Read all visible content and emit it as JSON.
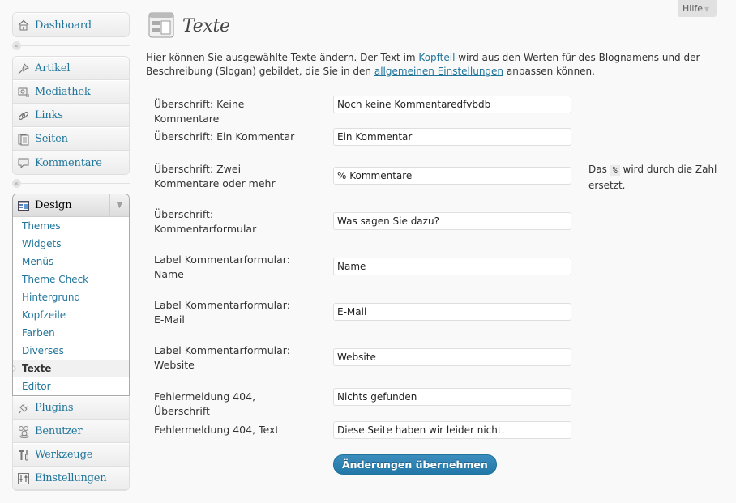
{
  "help": {
    "label": "Hilfe"
  },
  "sidebar": {
    "top": [
      {
        "label": "Dashboard",
        "icon": "dashboard-icon"
      }
    ],
    "content": [
      {
        "label": "Artikel",
        "icon": "pushpin-icon"
      },
      {
        "label": "Mediathek",
        "icon": "media-icon"
      },
      {
        "label": "Links",
        "icon": "link-icon"
      },
      {
        "label": "Seiten",
        "icon": "pages-icon"
      },
      {
        "label": "Kommentare",
        "icon": "comment-icon"
      }
    ],
    "design": {
      "label": "Design",
      "icon": "appearance-icon",
      "submenu": [
        {
          "label": "Themes"
        },
        {
          "label": "Widgets"
        },
        {
          "label": "Menüs"
        },
        {
          "label": "Theme Check"
        },
        {
          "label": "Hintergrund"
        },
        {
          "label": "Kopfzeile"
        },
        {
          "label": "Farben"
        },
        {
          "label": "Diverses"
        },
        {
          "label": "Texte",
          "current": true
        },
        {
          "label": "Editor"
        }
      ]
    },
    "bottom": [
      {
        "label": "Plugins",
        "icon": "plugin-icon"
      },
      {
        "label": "Benutzer",
        "icon": "users-icon"
      },
      {
        "label": "Werkzeuge",
        "icon": "tools-icon"
      },
      {
        "label": "Einstellungen",
        "icon": "settings-icon"
      }
    ]
  },
  "page": {
    "title": "Texte",
    "intro": {
      "part1": "Hier können Sie ausgewählte Texte ändern. Der Text im ",
      "link1": "Kopfteil",
      "part2": " wird aus den Werten für des Blognamens und der Beschreibung (Slogan) gebildet, die Sie in den ",
      "link2": "allgemeinen Einstellungen",
      "part3": " anpassen können."
    },
    "fields": [
      {
        "label": "Überschrift: Keine Kommentare",
        "value": "Noch keine Kommentaredfvbdb"
      },
      {
        "label": "Überschrift: Ein Kommentar",
        "value": "Ein Kommentar"
      },
      {
        "label": "Überschrift: Zwei Kommentare oder mehr",
        "value": "% Kommentare"
      },
      {
        "label": "Überschrift: Kommentarformular",
        "value": "Was sagen Sie dazu?"
      },
      {
        "label": "Label Kommentarformular: Name",
        "value": "Name"
      },
      {
        "label": "Label Kommentarformular: E-Mail",
        "value": "E-Mail"
      },
      {
        "label": "Label Kommentarformular: Website",
        "value": "Website"
      },
      {
        "label": "Fehlermeldung 404, Überschrift",
        "value": "Nichts gefunden"
      },
      {
        "label": "Fehlermeldung 404, Text",
        "value": "Diese Seite haben wir leider nicht."
      }
    ],
    "hint": {
      "before": "Das ",
      "code": "%",
      "after": " wird durch die Zahl ersetzt."
    },
    "submit_label": "Änderungen übernehmen"
  }
}
